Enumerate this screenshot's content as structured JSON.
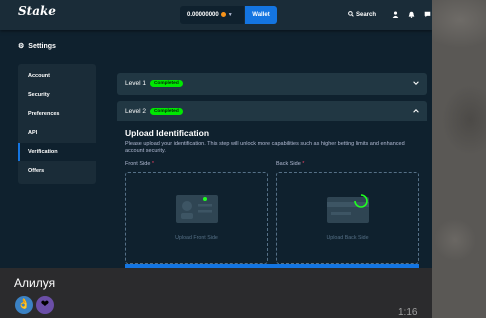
{
  "app": {
    "logo": "Stake"
  },
  "topbar": {
    "balance": "0.00000000",
    "wallet_label": "Wallet",
    "search_label": "Search"
  },
  "settings": {
    "title": "Settings",
    "sidebar": [
      {
        "label": "Account",
        "active": false
      },
      {
        "label": "Security",
        "active": false
      },
      {
        "label": "Preferences",
        "active": false
      },
      {
        "label": "API",
        "active": false
      },
      {
        "label": "Verification",
        "active": true
      },
      {
        "label": "Offers",
        "active": false
      }
    ],
    "level1": {
      "label": "Level 1",
      "badge": "Completed"
    },
    "level2": {
      "label": "Level 2",
      "badge": "Completed"
    },
    "upload": {
      "title": "Upload Identification",
      "description": "Please upload your identification. This step will unlock more capabilities such as higher betting limits and enhanced account security.",
      "front_label": "Front Side",
      "back_label": "Back Side",
      "required_mark": "*",
      "front_button": "Upload Front Side",
      "back_button": "Upload Back Side"
    }
  },
  "message": {
    "caption": "Алилуя",
    "time": "1:16",
    "reactions": [
      "thumbs-up-icon",
      "heart-icon"
    ]
  },
  "colors": {
    "background": "#0f212e",
    "panel": "#213743",
    "accent": "#1475e1",
    "completed": "#00e701"
  }
}
